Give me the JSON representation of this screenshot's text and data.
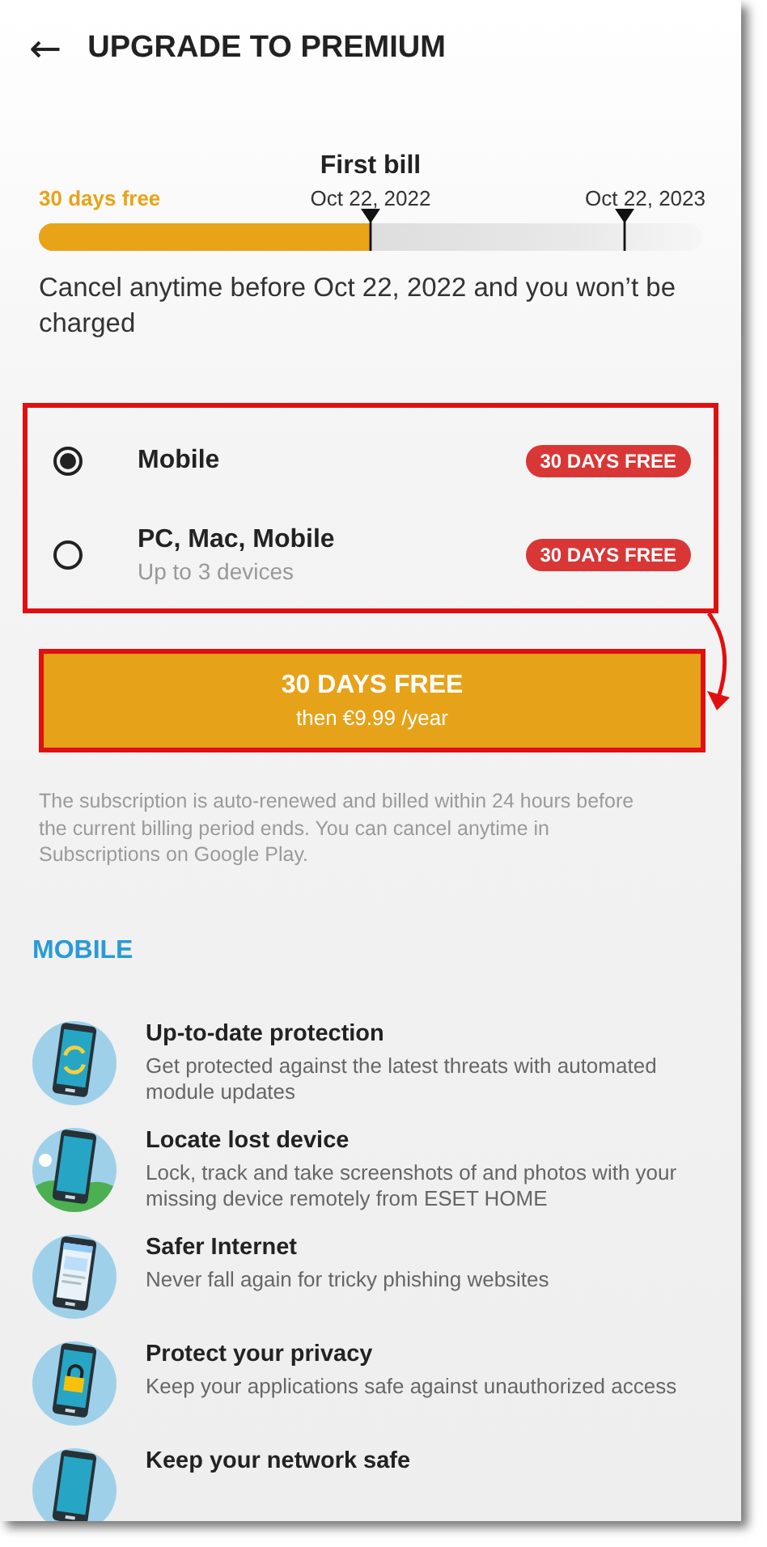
{
  "header": {
    "back_icon": "←",
    "title": "UPGRADE TO PREMIUM"
  },
  "timeline": {
    "free_label": "30 days free",
    "first_bill_label": "First bill",
    "first_bill_date": "Oct 22, 2022",
    "renewal_date": "Oct 22, 2023",
    "level": 0.5,
    "note": "Cancel anytime before Oct 22, 2022 and you won’t be charged"
  },
  "plan_options": {
    "highlighted": true,
    "items": [
      {
        "name": "Mobile",
        "badge": "30 DAYS FREE",
        "selected": true
      },
      {
        "name": "PC, Mac, Mobile",
        "detail": "Up to 3 devices",
        "badge": "30 DAYS FREE",
        "selected": false
      }
    ]
  },
  "cta_button": {
    "title": "30 DAYS FREE",
    "subtitle": "then €9.99 /year",
    "highlighted": true
  },
  "callout_arrow": true,
  "fine_print": "The subscription is auto-renewed and billed within 24 hours before the current billing period ends. You can cancel anytime in Subscriptions on Google Play.",
  "section_title": "MOBILE",
  "features": [
    {
      "kind": "sync",
      "title": "Up-to-date protection",
      "description": "Get protected against the latest threats with automated module updates"
    },
    {
      "kind": "locate",
      "title": "Locate lost device",
      "description": "Lock, track and take screenshots of and photos with your missing device remotely from ESET HOME"
    },
    {
      "kind": "browser",
      "title": "Safer Internet",
      "description": "Never fall again for tricky phishing websites"
    },
    {
      "kind": "lock",
      "title": "Protect your privacy",
      "description": "Keep your applications safe against unauthorized access"
    },
    {
      "kind": "network",
      "title": "Keep your network safe"
    }
  ]
}
